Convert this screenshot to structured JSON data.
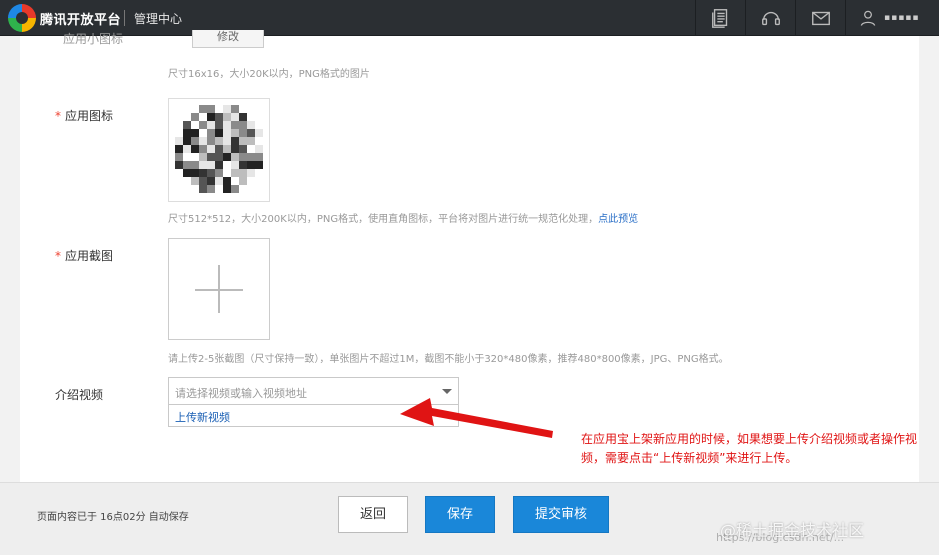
{
  "header": {
    "brand": "腾讯开放平台",
    "section": "管理中心",
    "icons": [
      "document-icon",
      "headset-icon",
      "mail-icon",
      "user-icon"
    ],
    "username_masked": "▪▪▪▪▪"
  },
  "form": {
    "small_icon_partial_label": "应用小图标",
    "upload_btn_partial": "修改",
    "small_icon_hint": "尺寸16x16，大小20K以内，PNG格式的图片",
    "app_icon_label": "应用图标",
    "app_icon_hint": "尺寸512*512，大小200K以内，PNG格式，使用直角图标，平台将对图片进行统一规范化处理，",
    "app_icon_preview_link": "点此预览",
    "screenshot_label": "应用截图",
    "screenshot_hint": "请上传2-5张截图（尺寸保持一致），单张图片不超过1M，截图不能小于320*480像素，推荐480*800像素，JPG、PNG格式。",
    "video_label": "介绍视频",
    "video_placeholder": "请选择视频或输入视频地址",
    "video_option_upload": "上传新视频"
  },
  "annotation": {
    "text": "在应用宝上架新应用的时候，如果想要上传介绍视频或者操作视频，需要点击“上传新视频”来进行上传。",
    "color": "#e01414"
  },
  "footer": {
    "autosave": "页面内容已于 16点02分 自动保存",
    "back": "返回",
    "save": "保存",
    "submit": "提交审核",
    "watermark": "@稀土掘金技术社区",
    "watermark_url": "https://blog.csdn.net/..."
  },
  "colors": {
    "topbar": "#2b2f33",
    "primary": "#1a87d9",
    "required": "#e43"
  }
}
